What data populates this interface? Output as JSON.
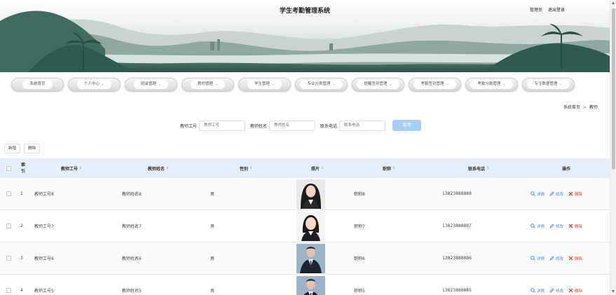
{
  "header": {
    "title": "学生考勤管理系统",
    "user": "管理员",
    "logout": "退出登录"
  },
  "nav": {
    "items": [
      {
        "label": "系统首页",
        "has_dropdown": false
      },
      {
        "label": "个人中心",
        "has_dropdown": true
      },
      {
        "label": "班级管理",
        "has_dropdown": true
      },
      {
        "label": "教师管理",
        "has_dropdown": true
      },
      {
        "label": "学生管理",
        "has_dropdown": true
      },
      {
        "label": "专业分类管理",
        "has_dropdown": true
      },
      {
        "label": "提醒签到管理",
        "has_dropdown": true
      },
      {
        "label": "考勤签到管理",
        "has_dropdown": true
      },
      {
        "label": "考勤分数管理",
        "has_dropdown": true
      },
      {
        "label": "专注数据管理",
        "has_dropdown": true
      }
    ]
  },
  "breadcrumb": {
    "home": "系统首页",
    "separator": ">",
    "current": "教师"
  },
  "search": {
    "fields": [
      {
        "label": "教师工号",
        "placeholder": "教师工号"
      },
      {
        "label": "教师姓名",
        "placeholder": "教师姓名"
      },
      {
        "label": "联系电话",
        "placeholder": "联系电话"
      }
    ],
    "button": "查询"
  },
  "actions": {
    "add": "新增",
    "delete": "删除"
  },
  "table": {
    "headers": {
      "index": "索引",
      "teacher_id": "教师工号",
      "teacher_name": "教师姓名",
      "gender": "性别",
      "photo": "照片",
      "title": "职称",
      "phone": "联系电话",
      "operations": "操作"
    },
    "row_actions": {
      "detail": "详情",
      "edit": "修改",
      "delete": "删除"
    },
    "rows": [
      {
        "index": "1",
        "teacher_id": "教师工号8",
        "teacher_name": "教师姓名8",
        "gender": "男",
        "title": "职称8",
        "phone": "13823888888",
        "photo_variant": "female-long-hair"
      },
      {
        "index": "2",
        "teacher_id": "教师工号7",
        "teacher_name": "教师姓名7",
        "gender": "男",
        "title": "职称7",
        "phone": "13823888887",
        "photo_variant": "female-short-hair"
      },
      {
        "index": "3",
        "teacher_id": "教师工号6",
        "teacher_name": "教师姓名6",
        "gender": "男",
        "title": "职称6",
        "phone": "13823888886",
        "photo_variant": "male-suit"
      },
      {
        "index": "4",
        "teacher_id": "教师工号5",
        "teacher_name": "教师姓名5",
        "gender": "男",
        "title": "职称5",
        "phone": "13823888885",
        "photo_variant": "male-suit"
      }
    ]
  },
  "colors": {
    "accent": "#3a8ee6",
    "danger": "#e53935",
    "search_button": "#a7cff6",
    "table_header": "#e5eefb"
  }
}
